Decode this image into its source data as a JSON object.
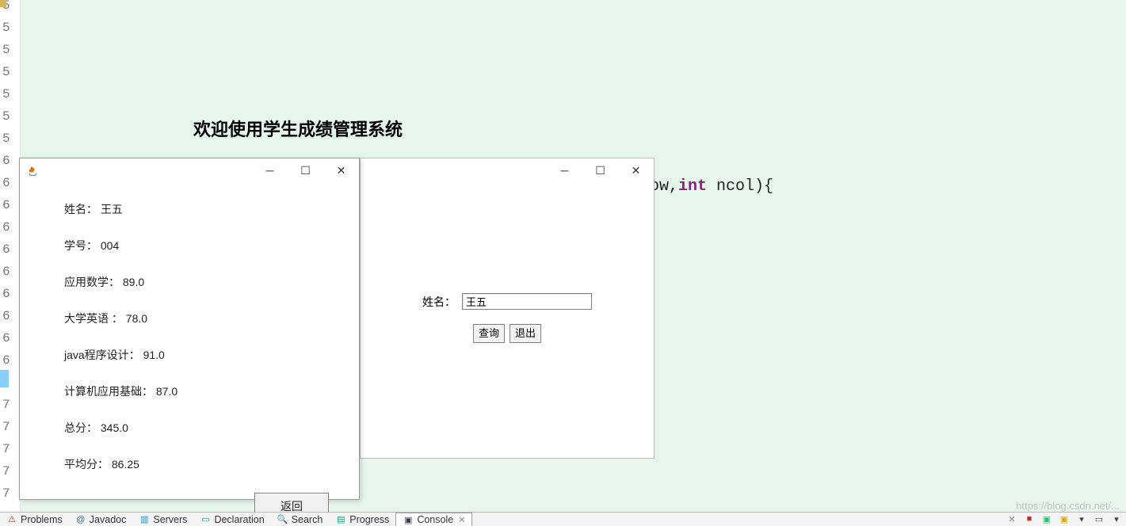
{
  "editor": {
    "line_numbers": [
      "5",
      "5",
      "5",
      "5",
      "5",
      "5",
      "5",
      "6",
      "6",
      "6",
      "6",
      "6",
      "6",
      "6",
      "6",
      "6",
      "6",
      "7",
      "7",
      "7",
      "7",
      "7",
      "7"
    ],
    "code_fragment_before": "ow,",
    "code_keyword": "int",
    "code_fragment_after": " ncol){"
  },
  "welcome": {
    "title": "欢迎使用学生成绩管理系统"
  },
  "result_window": {
    "name_label": "姓名：",
    "name_value": "王五",
    "sid_label": "学号：",
    "sid_value": "004",
    "math_label": "应用数学：",
    "math_value": "89.0",
    "english_label": "大学英语 ：",
    "english_value": "78.0",
    "java_label": "java程序设计：",
    "java_value": "91.0",
    "computer_label": "计算机应用基础：",
    "computer_value": "87.0",
    "total_label": "总分：",
    "total_value": "345.0",
    "avg_label": "平均分：",
    "avg_value": "86.25",
    "back_button": "返回"
  },
  "search_window": {
    "name_label": "姓名：",
    "name_input_value": "王五",
    "query_button": "查询",
    "exit_button": "退出"
  },
  "bottom_tabs": {
    "problems": "Problems",
    "javadoc": "Javadoc",
    "servers": "Servers",
    "declaration": "Declaration",
    "search": "Search",
    "progress": "Progress",
    "console": "Console"
  },
  "watermark": "https://blog.csdn.net/..."
}
